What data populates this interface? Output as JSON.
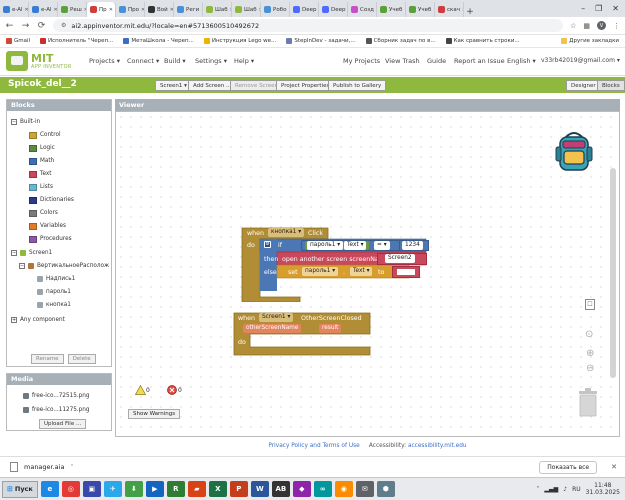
{
  "browser": {
    "tabs": [
      {
        "label": "e-Al",
        "color": "#3a7bd5"
      },
      {
        "label": "e-Al",
        "color": "#3a7bd5"
      },
      {
        "label": "Реш",
        "color": "#5ca03c"
      },
      {
        "label": "Пр",
        "color": "#cf3d3d",
        "active": true
      },
      {
        "label": "Про",
        "color": "#4a90d9"
      },
      {
        "label": "Вой",
        "color": "#333333"
      },
      {
        "label": "Реги",
        "color": "#4a90d9"
      },
      {
        "label": "Шаб",
        "color": "#8fb83f"
      },
      {
        "label": "Шаб",
        "color": "#8fb83f"
      },
      {
        "label": "Робо",
        "color": "#4a90d9"
      },
      {
        "label": "Deep",
        "color": "#4d6bfe"
      },
      {
        "label": "Deep",
        "color": "#4d6bfe"
      },
      {
        "label": "Созд",
        "color": "#c94fc9"
      },
      {
        "label": "Учеб",
        "color": "#5ca03c"
      },
      {
        "label": "Учеб",
        "color": "#5ca03c"
      },
      {
        "label": "скач",
        "color": "#cf3d3d"
      }
    ],
    "new_tab_symbol": "+",
    "window_controls": [
      "–",
      "❐",
      "✕"
    ],
    "back_symbol": "←",
    "forward_symbol": "→",
    "reload_symbol": "⟳",
    "url": "ai2.appinventor.mit.edu/?locale=en#5713600510492672",
    "avatar_letter": "V",
    "bookmarks": [
      {
        "label": "Gmail",
        "color": "#d44638"
      },
      {
        "label": "Исполнитель \"Череп...",
        "color": "#c8302f"
      },
      {
        "label": "МетаШкола - Череп...",
        "color": "#3c6ec8"
      },
      {
        "label": "Инструкция Lego we...",
        "color": "#f2b200"
      },
      {
        "label": "StepInDev - задачи,...",
        "color": "#6c7cb3"
      },
      {
        "label": "Сборник задач по в...",
        "color": "#555555"
      },
      {
        "label": "Как сравнить строки...",
        "color": "#444444"
      }
    ],
    "other_bookmarks": "Другие закладки"
  },
  "app": {
    "logo_line1": "MIT",
    "logo_line2": "APP INVENTOR",
    "menus": [
      "Projects ▾",
      "Connect ▾",
      "Build ▾",
      "Settings ▾",
      "Help ▾"
    ],
    "right_links": [
      "My Projects",
      "View Trash",
      "Guide",
      "Report an Issue",
      "English ▾",
      "v33rb42019@gmail.com ▾"
    ],
    "project_name": "Spicok_del__2",
    "toolbar": {
      "screen_select": "Screen1 ▾",
      "add_screen": "Add Screen ...",
      "remove_screen": "Remove Screen",
      "project_properties": "Project Properties",
      "publish": "Publish to Gallery",
      "designer": "Designer",
      "blocks": "Blocks"
    }
  },
  "blocks_panel": {
    "title": "Blocks",
    "builtin_label": "Built-in",
    "builtin": [
      {
        "label": "Control",
        "color": "#c8a63a"
      },
      {
        "label": "Logic",
        "color": "#5b8c3f"
      },
      {
        "label": "Math",
        "color": "#3b6fb6"
      },
      {
        "label": "Text",
        "color": "#c9485b"
      },
      {
        "label": "Lists",
        "color": "#6bb6d6"
      },
      {
        "label": "Dictionaries",
        "color": "#2d3a8c"
      },
      {
        "label": "Colors",
        "color": "#7a7a7a"
      },
      {
        "label": "Variables",
        "color": "#e07b2a"
      },
      {
        "label": "Procedures",
        "color": "#8b5aa5"
      }
    ],
    "screen_label": "Screen1",
    "arrangement_label": "ВертикальноеРасполож",
    "components": [
      "Надпись1",
      "пароль1",
      "кнопка1"
    ],
    "any_component": "Any component",
    "rename_label": "Rename",
    "delete_label": "Delete"
  },
  "media_panel": {
    "title": "Media",
    "files": [
      "free-ico...72515.png",
      "free-ico...11275.png"
    ],
    "upload_label": "Upload File ..."
  },
  "viewer": {
    "title": "Viewer",
    "warnings_count": "0",
    "errors_count": "0",
    "show_warnings": "Show Warnings"
  },
  "blocks": {
    "click_event": {
      "when": "when",
      "component": "кнопка1 ▾",
      "event": "Click",
      "do": "do",
      "if": "if",
      "then": "then",
      "else": "else",
      "compare_component": "пароль1 ▾",
      "compare_prop": "Text ▾",
      "compare_op": "= ▾",
      "compare_value": "1234",
      "open_screen": "open another screen  screenName",
      "screen_value": "Screen2",
      "set": "set",
      "set_component": "пароль1 ▾",
      "set_dot": ".",
      "set_prop": "Text ▾",
      "to": "to"
    },
    "closed_event": {
      "when": "when",
      "component": "Screen1 ▾",
      "event": "OtherScreenClosed",
      "param1": "otherScreenName",
      "param2": "result",
      "do": "do"
    }
  },
  "footer": {
    "privacy": "Privacy Policy and Terms of Use",
    "accessibility_label": "Accessibility:",
    "accessibility_link": "accessibility.mit.edu"
  },
  "download_bar": {
    "file": "manager.aia",
    "show_all": "Показать все"
  },
  "taskbar": {
    "start_label": "Пуск",
    "apps": [
      {
        "label": "e",
        "color": "#1e88e5"
      },
      {
        "label": "◎",
        "color": "#e53935"
      },
      {
        "label": "▣",
        "color": "#3949ab"
      },
      {
        "label": "✈",
        "color": "#29a9eb"
      },
      {
        "label": "⬇",
        "color": "#43a047"
      },
      {
        "label": "▶",
        "color": "#1565c0"
      },
      {
        "label": "R",
        "color": "#2e7d32"
      },
      {
        "label": "▰",
        "color": "#d84315"
      },
      {
        "label": "X",
        "color": "#1e7145"
      },
      {
        "label": "P",
        "color": "#c43e1c"
      },
      {
        "label": "W",
        "color": "#2b579a"
      },
      {
        "label": "AB",
        "color": "#333333"
      },
      {
        "label": "◆",
        "color": "#8e24aa"
      },
      {
        "label": "∞",
        "color": "#00979d"
      },
      {
        "label": "◉",
        "color": "#fb8c00"
      },
      {
        "label": "✉",
        "color": "#5f6368"
      },
      {
        "label": "⬢",
        "color": "#607d8b"
      }
    ],
    "tray_lang": "RU",
    "time": "11:48",
    "date": "31.03.2025"
  }
}
